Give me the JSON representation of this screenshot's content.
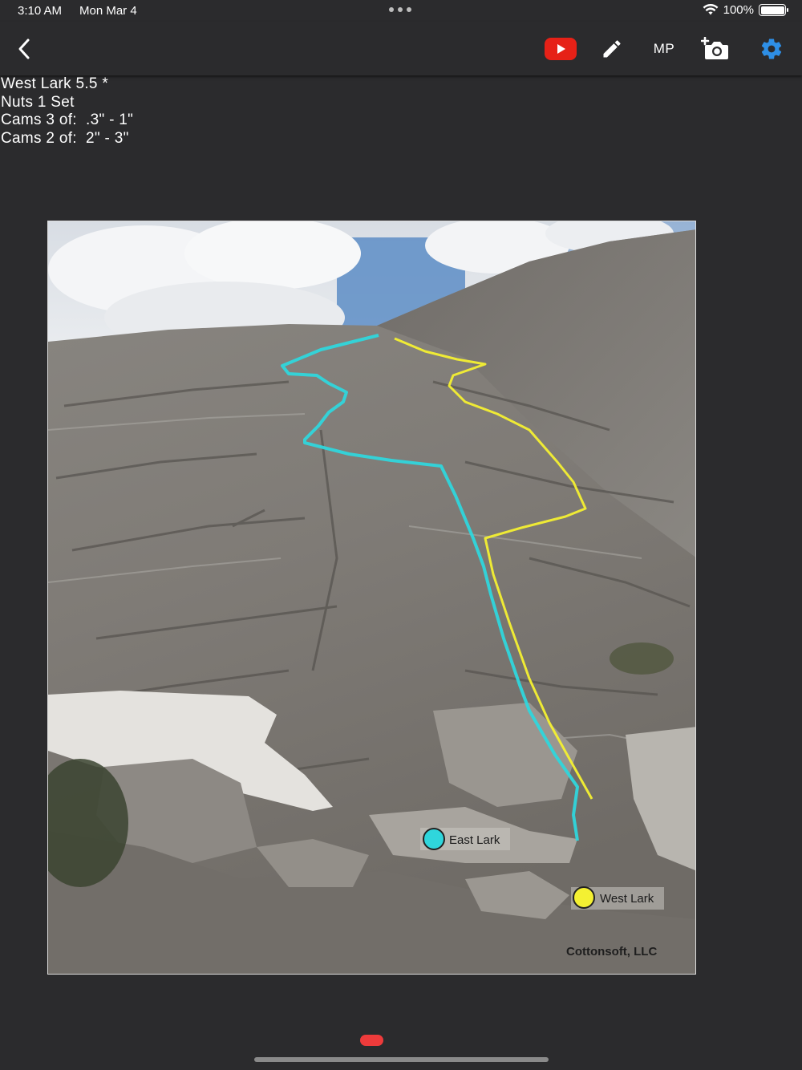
{
  "status_bar": {
    "time": "3:10 AM",
    "date": "Mon Mar 4",
    "battery": "100%"
  },
  "toolbar": {
    "back_icon": "chevron-left-icon",
    "youtube_icon": "youtube-play-icon",
    "edit_icon": "pencil-icon",
    "mp_label": "MP",
    "add_photo_icon": "add-photo-icon",
    "settings_icon": "gear-icon",
    "colors": {
      "youtube": "#e62117",
      "settings": "#2e8fe6"
    }
  },
  "notes": {
    "line1": "West Lark 5.5 *",
    "line2": "Nuts 1 Set",
    "line3": "Cams 3 of:  .3\" - 1\"",
    "line4": "Cams 2 of:  2\" - 3\""
  },
  "topo": {
    "routes": [
      {
        "name": "East Lark",
        "color": "#2fd6dc"
      },
      {
        "name": "West Lark",
        "color": "#f4f032"
      }
    ],
    "watermark": "Cottonsoft, LLC"
  }
}
